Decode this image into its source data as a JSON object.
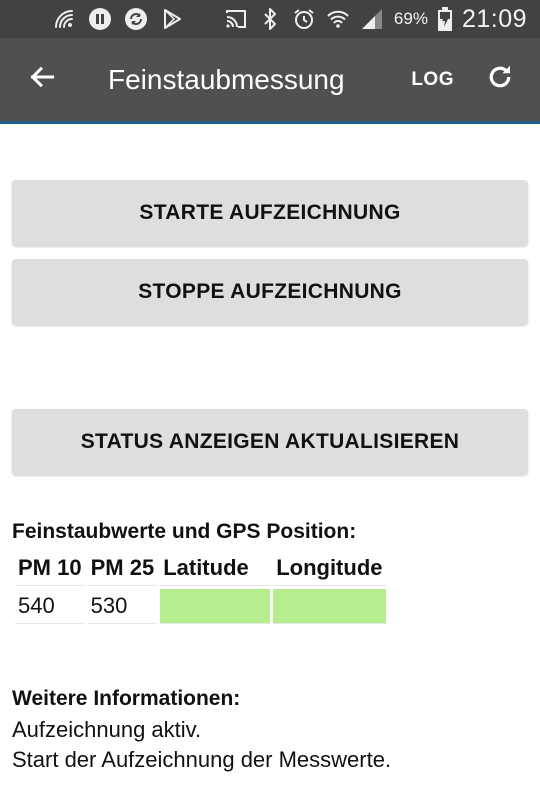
{
  "status_bar": {
    "icons": [
      "nfc-signal-icon",
      "pause-circle-icon",
      "sync-icon",
      "play-store-icon",
      "cast-icon",
      "bluetooth-icon",
      "alarm-icon",
      "wifi-icon",
      "cell-signal-icon",
      "battery-charging-icon"
    ],
    "battery_percent": "69%",
    "time": "21:09"
  },
  "app_bar": {
    "title": "Feinstaubmessung",
    "log_label": "LOG",
    "back_icon": "arrow-back-icon",
    "refresh_icon": "refresh-icon"
  },
  "buttons": {
    "start": "STARTE AUFZEICHNUNG",
    "stop": "STOPPE AUFZEICHNUNG",
    "status": "STATUS ANZEIGEN AKTUALISIEREN"
  },
  "values": {
    "heading": "Feinstaubwerte und GPS Position:",
    "columns": [
      "PM 10",
      "PM 25",
      "Latitude",
      "Longitude"
    ],
    "rows": [
      {
        "pm10": "540",
        "pm25": "530",
        "latitude": "",
        "longitude": ""
      }
    ],
    "gps_cell_color": "#b6ee8f"
  },
  "info": {
    "heading": "Weitere Informationen:",
    "lines": [
      "Aufzeichnung aktiv.",
      "Start der Aufzeichnung der Messwerte."
    ]
  },
  "colors": {
    "status_bar_bg": "#424242",
    "app_bar_bg": "#505050",
    "accent_line": "#1d5f86",
    "button_bg": "#dedede"
  }
}
